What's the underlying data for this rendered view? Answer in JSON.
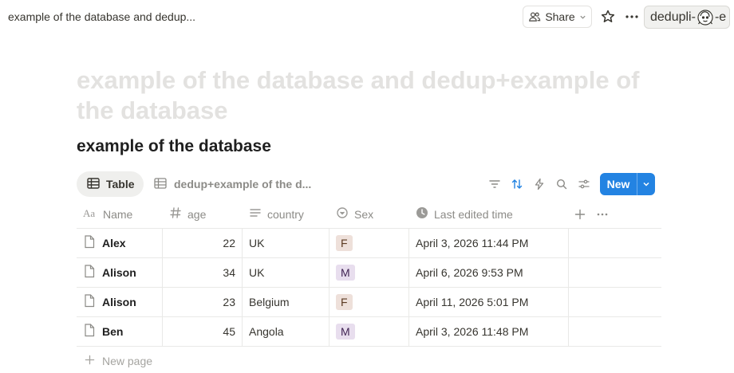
{
  "topbar": {
    "breadcrumb": "example of the database and dedup...",
    "share_label": "Share",
    "dedup_chip_prefix": "dedupli-",
    "dedup_chip_suffix": "-e"
  },
  "page": {
    "title": "example of the database and dedup+example of the database",
    "database_title": "example of the database"
  },
  "views": {
    "tabs": [
      {
        "label": "Table",
        "icon": "table-icon",
        "active": true
      },
      {
        "label": "dedup+example of the d...",
        "icon": "table-icon",
        "active": false
      }
    ],
    "toolbar_icons": [
      "filter-icon",
      "sort-icon",
      "automation-icon",
      "search-icon",
      "settings-icon"
    ],
    "new_label": "New"
  },
  "table": {
    "columns": [
      {
        "label": "Name",
        "icon": "text-icon"
      },
      {
        "label": "age",
        "icon": "number-icon"
      },
      {
        "label": "country",
        "icon": "text-lines-icon"
      },
      {
        "label": "Sex",
        "icon": "select-icon"
      },
      {
        "label": "Last edited time",
        "icon": "clock-icon"
      }
    ],
    "rows": [
      {
        "name": "Alex",
        "age": "22",
        "country": "UK",
        "sex": "F",
        "last_edited": "April 3, 2026 11:44 PM"
      },
      {
        "name": "Alison",
        "age": "34",
        "country": "UK",
        "sex": "M",
        "last_edited": "April 6, 2026 9:53 PM"
      },
      {
        "name": "Alison",
        "age": "23",
        "country": "Belgium",
        "sex": "F",
        "last_edited": "April 11, 2026 5:01 PM"
      },
      {
        "name": "Ben",
        "age": "45",
        "country": "Angola",
        "sex": "M",
        "last_edited": "April 3, 2026 11:48 PM"
      }
    ],
    "new_page_label": "New page"
  },
  "colors": {
    "accent": "#2383e2",
    "tag_F_bg": "#eee0da",
    "tag_F_text": "#5c3b23",
    "tag_M_bg": "#e8deee",
    "tag_M_text": "#412454",
    "title_placeholder": "#e3e2e0"
  }
}
